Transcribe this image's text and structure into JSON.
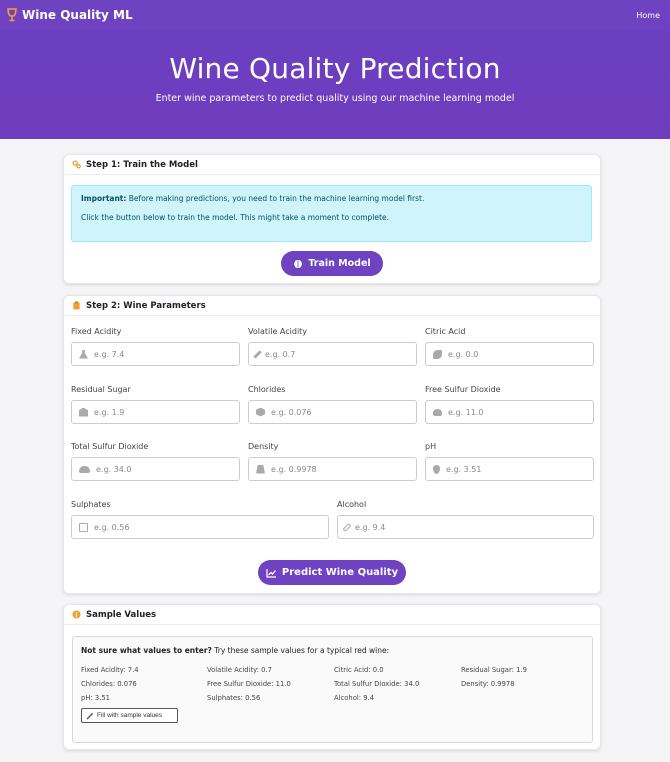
{
  "nav": {
    "brand": "Wine Quality ML",
    "home": "Home"
  },
  "hero": {
    "title": "Wine Quality Prediction",
    "subtitle": "Enter wine parameters to predict quality using our machine learning model"
  },
  "step1": {
    "title": "Step 1: Train the Model",
    "alert_strong": "Important:",
    "alert_text": " Before making predictions, you need to train the machine learning model first.",
    "alert_line2": "Click the button below to train the model. This might take a moment to complete.",
    "button": "Train Model"
  },
  "step2": {
    "title": "Step 2: Wine Parameters",
    "fields": [
      {
        "label": "Fixed Acidity",
        "placeholder": "e.g. 7.4"
      },
      {
        "label": "Volatile Acidity",
        "placeholder": "e.g. 0.7"
      },
      {
        "label": "Citric Acid",
        "placeholder": "e.g. 0.0"
      },
      {
        "label": "Residual Sugar",
        "placeholder": "e.g. 1.9"
      },
      {
        "label": "Chlorides",
        "placeholder": "e.g. 0.076"
      },
      {
        "label": "Free Sulfur Dioxide",
        "placeholder": "e.g. 11.0"
      },
      {
        "label": "Total Sulfur Dioxide",
        "placeholder": "e.g. 34.0"
      },
      {
        "label": "Density",
        "placeholder": "e.g. 0.9978"
      },
      {
        "label": "pH",
        "placeholder": "e.g. 3.51"
      },
      {
        "label": "Sulphates",
        "placeholder": "e.g. 0.56"
      },
      {
        "label": "Alcohol",
        "placeholder": "e.g. 9.4"
      }
    ],
    "button": "Predict Wine Quality"
  },
  "samples": {
    "title": "Sample Values",
    "intro_strong": "Not sure what values to enter?",
    "intro_text": " Try these sample values for a typical red wine:",
    "values": [
      "Fixed Acidity: 7.4",
      "Volatile Acidity: 0.7",
      "Citric Acid: 0.0",
      "Residual Sugar: 1.9",
      "Chlorides: 0.076",
      "Free Sulfur Dioxide: 11.0",
      "Total Sulfur Dioxide: 34.0",
      "Density: 0.9978",
      "pH: 3.51",
      "Sulphates: 0.56",
      "Alcohol: 9.4"
    ],
    "fill_button": "Fill with sample values"
  },
  "colors": {
    "primary": "#6f42c1",
    "alert_bg": "#cff4fc",
    "alert_text": "#055160",
    "accent_orange": "#f0a030"
  },
  "icons": {
    "brand": "wine-glass-icon",
    "step1": "cogs-icon",
    "train": "brain-icon",
    "step2": "clipboard-icon",
    "predict": "chart-line-icon",
    "samples": "info-circle-icon",
    "fill": "magic-wand-icon"
  }
}
